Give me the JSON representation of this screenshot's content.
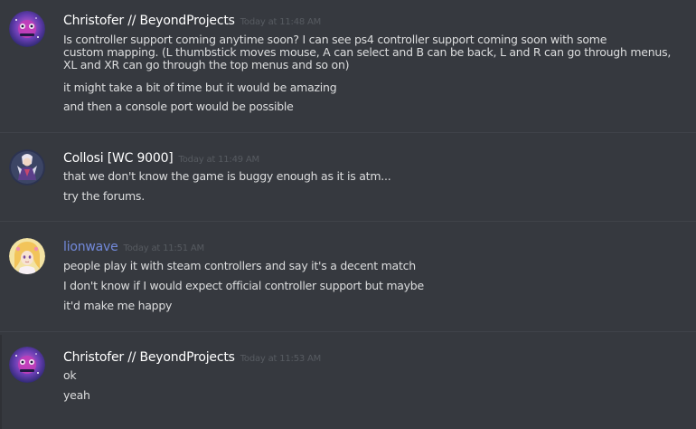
{
  "messages": [
    {
      "author": "Christofer // BeyondProjects",
      "timestamp": "Today at 11:48 AM",
      "avatar": "galaxy-avatar-icon",
      "lines": [
        "Is controller support coming anytime soon? I can see ps4 controller support coming soon with some\ncustom mapping. (L thumbstick moves mouse, A can select and B can be back, L and R can go through menus,\nXL and XR can go through the top menus and so on)",
        "it might take a bit of time but it would be amazing",
        "and then a console port would be possible"
      ]
    },
    {
      "author": "Collosi [WC 9000]",
      "timestamp": "Today at 11:49 AM",
      "avatar": "character-avatar-icon",
      "lines": [
        "that we don't know the game is buggy enough as it is atm...",
        "try the forums."
      ]
    },
    {
      "author": "lionwave",
      "timestamp": "Today at 11:51 AM",
      "avatar": "anime-avatar-icon",
      "lines": [
        "people play it with steam controllers and say it's a decent match",
        "I don't know if I would expect official controller support but maybe",
        "it'd make me happy"
      ]
    },
    {
      "author": "Christofer // BeyondProjects",
      "timestamp": "Today at 11:53 AM",
      "avatar": "galaxy-avatar-icon",
      "lines": [
        "ok",
        "yeah"
      ]
    }
  ],
  "colors": {
    "background": "#36393f",
    "username": "#ffffff",
    "username_highlight": "#7289da",
    "timestamp": "#575b61",
    "message_text": "#dcddde",
    "divider": "#40434a"
  }
}
